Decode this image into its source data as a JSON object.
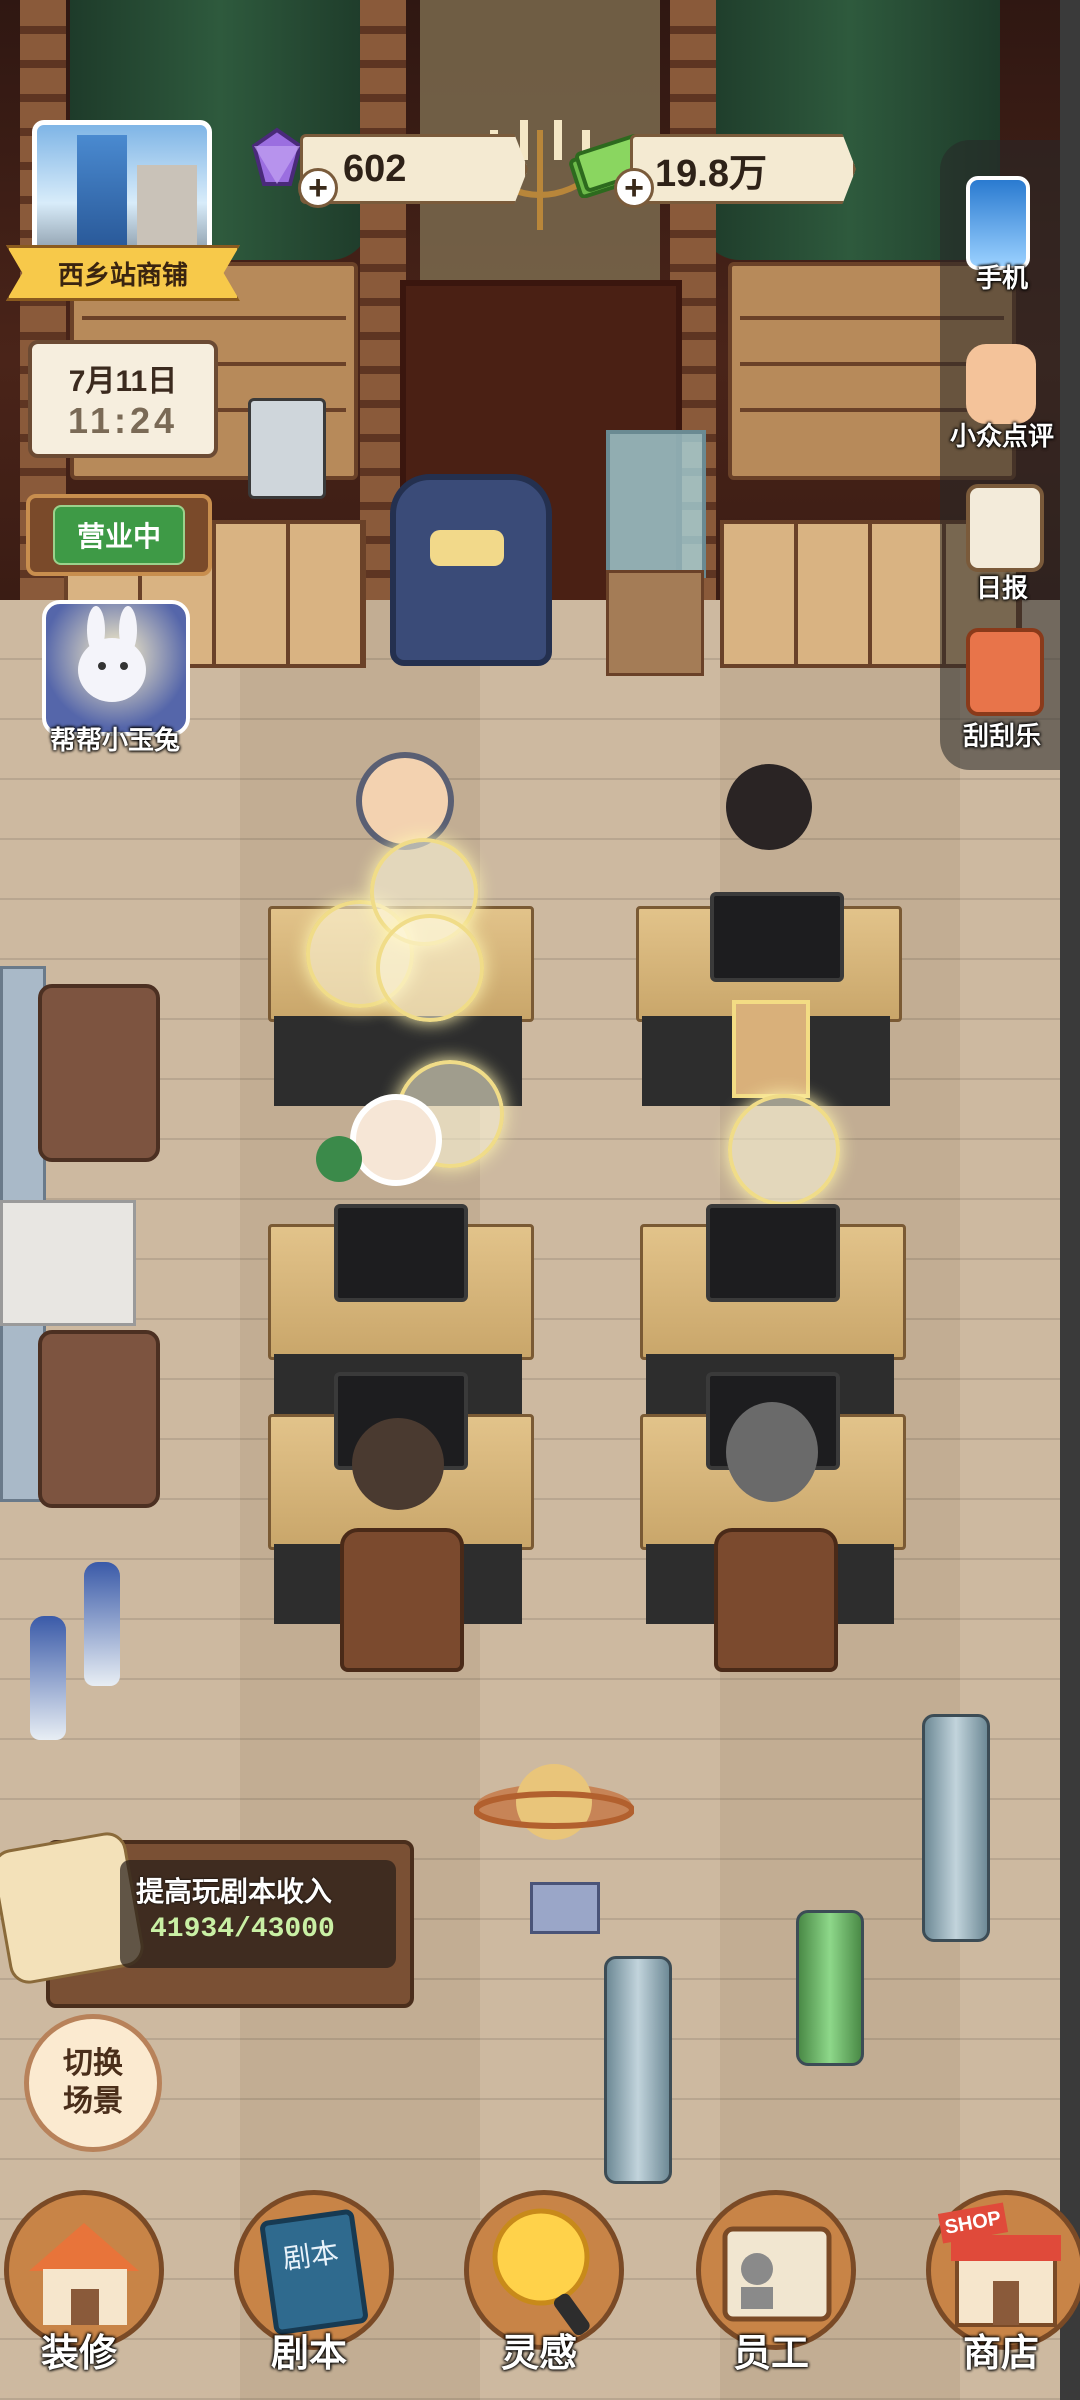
{
  "shop": {
    "name": "西乡站商铺"
  },
  "currency": {
    "gems": "602",
    "cash": "19.8万"
  },
  "clock": {
    "date": "7月11日",
    "time": "11:24"
  },
  "status": {
    "open_label": "营业中"
  },
  "helper": {
    "label": "帮帮小玉兔"
  },
  "side_menu": [
    {
      "label": "手机",
      "icon": "phone-icon"
    },
    {
      "label": "小众点评",
      "icon": "thumbs-up-icon"
    },
    {
      "label": "日报",
      "icon": "clipboard-icon"
    },
    {
      "label": "刮刮乐",
      "icon": "scratch-ticket-icon"
    }
  ],
  "quest": {
    "title": "提高玩剧本收入",
    "progress": "41934/43000",
    "progress_fraction": 0.975
  },
  "scene_button": {
    "label": "切换场景"
  },
  "bottom_nav": [
    {
      "label": "装修",
      "icon": "house-icon"
    },
    {
      "label": "剧本",
      "icon": "book-icon"
    },
    {
      "label": "灵感",
      "icon": "lightbulb-icon"
    },
    {
      "label": "员工",
      "icon": "id-badge-icon"
    },
    {
      "label": "商店",
      "icon": "shop-icon",
      "badge": "SHOP"
    }
  ],
  "colors": {
    "accent": "#f7c94a",
    "open_green": "#3e9a46",
    "ui_brown": "#7a4a26"
  }
}
